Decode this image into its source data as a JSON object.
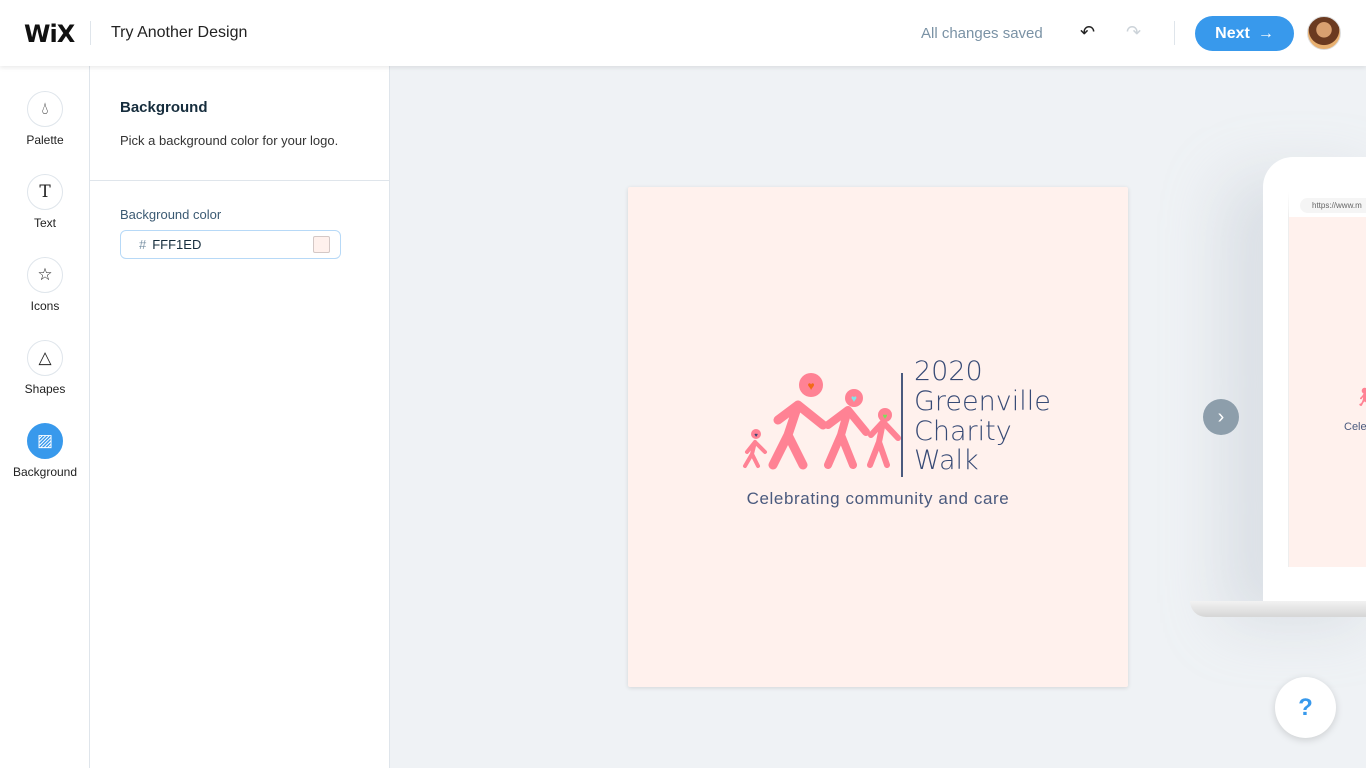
{
  "header": {
    "logo": "WiX",
    "title": "Try Another Design",
    "status": "All changes saved",
    "next_label": "Next"
  },
  "rail": [
    {
      "label": "Palette",
      "icon": "palette-icon"
    },
    {
      "label": "Text",
      "icon": "text-icon"
    },
    {
      "label": "Icons",
      "icon": "star-icon"
    },
    {
      "label": "Shapes",
      "icon": "shapes-icon"
    },
    {
      "label": "Background",
      "icon": "background-icon",
      "active": true
    }
  ],
  "panel": {
    "title": "Background",
    "description": "Pick a background color for your logo.",
    "field_label": "Background color",
    "hash": "#",
    "value": "FFF1ED"
  },
  "logo_preview": {
    "line1": "2020",
    "line2": "Greenville",
    "line3": "Charity",
    "line4": "Walk",
    "tagline": "Celebrating community and care",
    "bg": "#FFF1ED",
    "figure_color": "#FF8294",
    "text_color": "#374A75"
  },
  "mockup": {
    "url": "https://www.m",
    "tagline_partial": "Cele"
  },
  "help": "?"
}
